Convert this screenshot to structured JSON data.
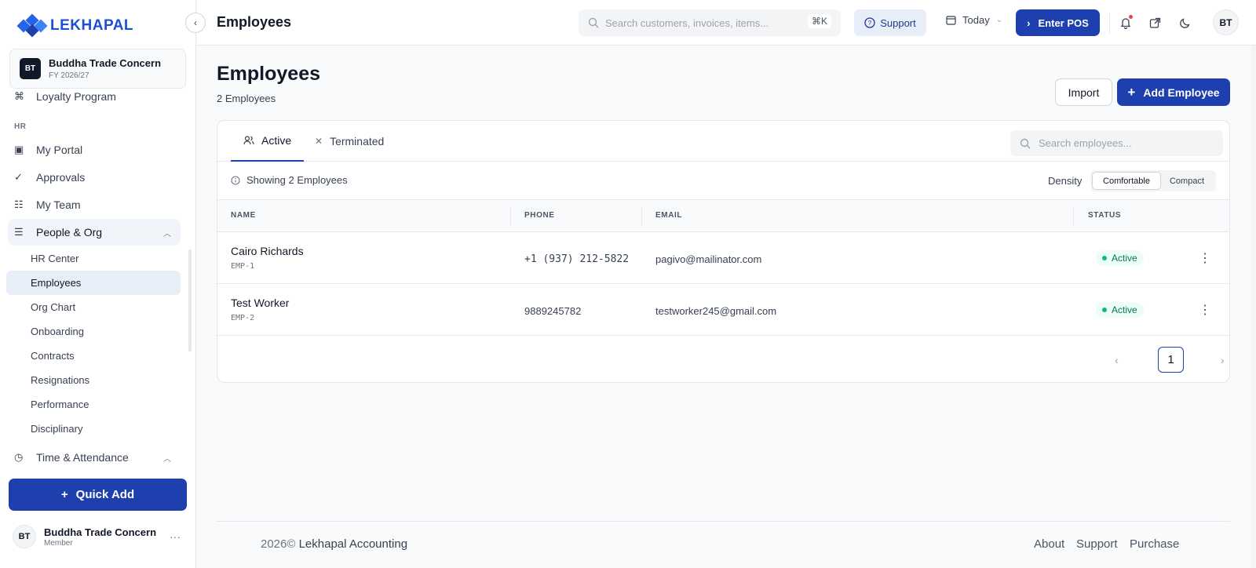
{
  "brand": {
    "name": "LEKHAPAL",
    "accent": "#1e40af"
  },
  "org": {
    "initials": "BT",
    "name": "Buddha Trade Concern",
    "fy": "FY 2026/27"
  },
  "sidebar": {
    "top_item": {
      "label": "Loyalty Program",
      "icon": "loyalty-icon"
    },
    "section_hr": "HR",
    "items": [
      {
        "label": "My Portal",
        "icon": "portal-icon"
      },
      {
        "label": "Approvals",
        "icon": "approvals-icon"
      },
      {
        "label": "My Team",
        "icon": "team-icon"
      },
      {
        "label": "People & Org",
        "icon": "people-icon"
      }
    ],
    "sub_items": [
      {
        "label": "HR Center"
      },
      {
        "label": "Employees"
      },
      {
        "label": "Org Chart"
      },
      {
        "label": "Onboarding"
      },
      {
        "label": "Contracts"
      },
      {
        "label": "Resignations"
      },
      {
        "label": "Performance"
      },
      {
        "label": "Disciplinary"
      }
    ],
    "time_item": {
      "label": "Time & Attendance",
      "icon": "clock-icon"
    },
    "quick_add": "Quick Add",
    "user": {
      "initials": "BT",
      "name": "Buddha Trade Concern",
      "role": "Member"
    }
  },
  "topbar": {
    "title": "Employees",
    "search_placeholder": "Search customers, invoices, items...",
    "shortcut": "⌘K",
    "support": "Support",
    "date_filter": "Today",
    "pos_button": "Enter POS",
    "avatar": "BT"
  },
  "page": {
    "title": "Employees",
    "subtitle": "2 Employees",
    "import": "Import",
    "add": "Add Employee"
  },
  "tabs": [
    {
      "label": "Active"
    },
    {
      "label": "Terminated"
    }
  ],
  "employee_search_placeholder": "Search employees...",
  "toolbar": {
    "showing": "Showing 2 Employees",
    "density_label": "Density",
    "density_options": [
      "Comfortable",
      "Compact"
    ],
    "density_selected": "Comfortable"
  },
  "table": {
    "columns": [
      "NAME",
      "PHONE",
      "EMAIL",
      "STATUS"
    ],
    "rows": [
      {
        "name": "Cairo Richards",
        "code": "EMP-1",
        "phone": "+1 (937) 212-5822",
        "email": "pagivo@mailinator.com",
        "status": "Active"
      },
      {
        "name": "Test Worker",
        "code": "EMP-2",
        "phone": "9889245782",
        "email": "testworker245@gmail.com",
        "status": "Active"
      }
    ]
  },
  "pagination": {
    "current": "1"
  },
  "footer": {
    "year": "2026©",
    "company": "Lekhapal Accounting",
    "links": [
      "About",
      "Support",
      "Purchase"
    ]
  }
}
